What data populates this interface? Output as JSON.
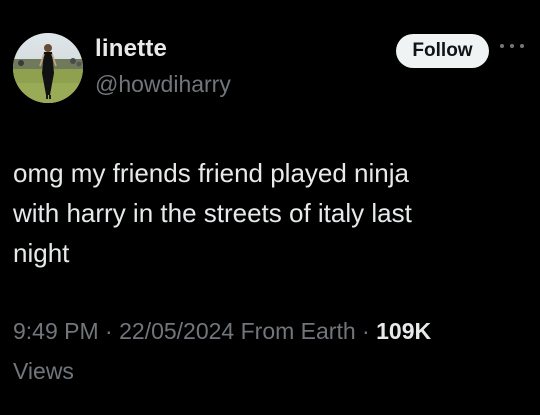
{
  "user": {
    "display_name": "linette",
    "handle": "@howdiharry"
  },
  "header": {
    "follow_label": "Follow",
    "more_icon": "more-horizontal-icon"
  },
  "tweet": {
    "text": "omg my friends friend played ninja\nwith harry in the streets of italy last\nnight"
  },
  "meta": {
    "time": "9:49 PM",
    "sep1": " · ",
    "date": "22/05/2024",
    "source": " From Earth",
    "sep2": " · ",
    "views_count": "109K",
    "views_label": "Views"
  },
  "colors": {
    "background": "#000000",
    "text_primary": "#e7e9ea",
    "text_secondary": "#71767b",
    "button_bg": "#eff3f4",
    "button_text": "#0f1419"
  }
}
